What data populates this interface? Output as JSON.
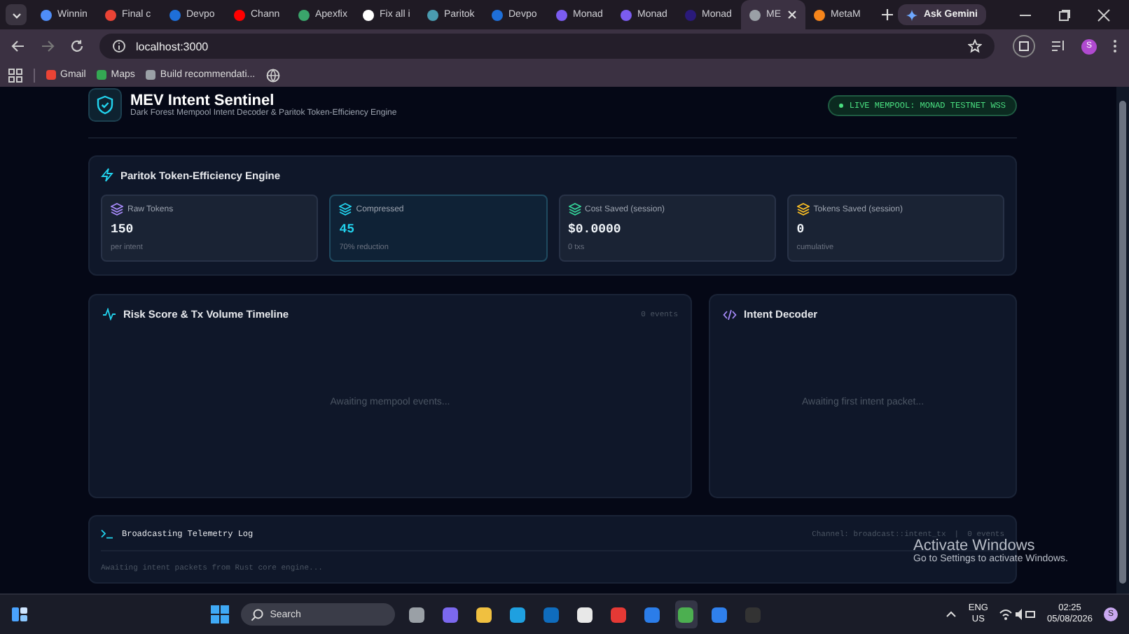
{
  "browser": {
    "tabs": [
      {
        "label": "Winnin",
        "color": "#4f8df7",
        "selected": false
      },
      {
        "label": "Final c",
        "color": "#ea4335",
        "selected": false
      },
      {
        "label": "Devpo",
        "color": "#1e6fd9",
        "selected": false
      },
      {
        "label": "Chann",
        "color": "#ff0000",
        "selected": false
      },
      {
        "label": "Apexfix",
        "color": "#3aa56b",
        "selected": false
      },
      {
        "label": "Fix all i",
        "color": "#ffffff",
        "selected": false
      },
      {
        "label": "Paritok",
        "color": "#4a9bb0",
        "selected": false
      },
      {
        "label": "Devpo",
        "color": "#1e6fd9",
        "selected": false
      },
      {
        "label": "Monad",
        "color": "#7b5cf0",
        "selected": false
      },
      {
        "label": "Monad",
        "color": "#7b5cf0",
        "selected": false
      },
      {
        "label": "Monad",
        "color": "#2a1a7a",
        "selected": false
      },
      {
        "label": "ME",
        "color": "#9aa0a6",
        "selected": true
      },
      {
        "label": "MetaM",
        "color": "#f6851b",
        "selected": false
      }
    ],
    "ask_button": "Ask Gemini",
    "url": "localhost:3000",
    "profile": "S",
    "bookmarks": [
      {
        "label": "Gmail",
        "color": "#ea4335"
      },
      {
        "label": "Maps",
        "color": "#34a853"
      },
      {
        "label": "Build recommendati...",
        "color": "#9aa0a6"
      }
    ]
  },
  "app": {
    "title": "MEV Intent Sentinel",
    "subtitle": "Dark Forest Mempool Intent Decoder & Paritok Token-Efficiency Engine",
    "status_badge": "LIVE MEMPOOL: MONAD TESTNET WSS",
    "engine": {
      "title": "Paritok Token-Efficiency Engine",
      "stats": [
        {
          "label": "Raw Tokens",
          "value": "150",
          "note": "per intent",
          "color": "#a78bfa",
          "selected": false
        },
        {
          "label": "Compressed",
          "value": "45",
          "note": "70% reduction",
          "color": "#22d3ee",
          "selected": true
        },
        {
          "label": "Cost Saved (session)",
          "value": "$0.0000",
          "note": "0 txs",
          "color": "#34d399",
          "selected": false
        },
        {
          "label": "Tokens Saved (session)",
          "value": "0",
          "note": "cumulative",
          "color": "#fbbf24",
          "selected": false
        }
      ]
    },
    "timeline": {
      "title": "Risk Score & Tx Volume Timeline",
      "count": "0 events",
      "empty": "Awaiting mempool events..."
    },
    "decoder": {
      "title": "Intent Decoder",
      "empty": "Awaiting first intent packet..."
    },
    "log": {
      "title": "Broadcasting Telemetry Log",
      "channel": "Channel: broadcast::intent_tx",
      "separator": "|",
      "count": "0 events",
      "empty": "Awaiting intent packets from Rust core engine..."
    }
  },
  "activation": {
    "title": "Activate Windows",
    "text": "Go to Settings to activate Windows."
  },
  "taskbar": {
    "search": "Search",
    "apps": [
      {
        "color": "#9aa0a6",
        "selected": false
      },
      {
        "color": "#7b68ee",
        "selected": false
      },
      {
        "color": "#f0c040",
        "selected": false
      },
      {
        "color": "#1fa0e0",
        "selected": false
      },
      {
        "color": "#0f6cbd",
        "selected": false
      },
      {
        "color": "#e8e8e8",
        "selected": false
      },
      {
        "color": "#e53935",
        "selected": false
      },
      {
        "color": "#2b7de9",
        "selected": false
      },
      {
        "color": "#4caf50",
        "selected": true
      },
      {
        "color": "#2f80ed",
        "selected": false
      },
      {
        "color": "#333333",
        "selected": false
      }
    ],
    "profile": "S",
    "language": "ENG",
    "region": "US",
    "time": "02:25",
    "date": "05/08/2026"
  }
}
